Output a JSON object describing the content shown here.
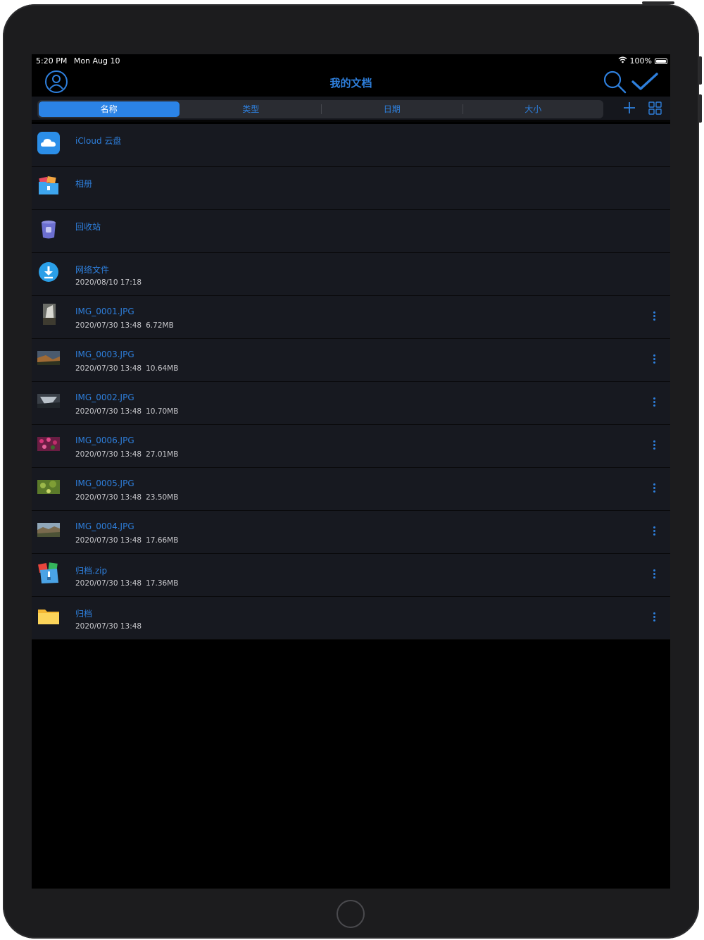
{
  "status_bar": {
    "time": "5:20 PM",
    "date": "Mon Aug 10",
    "battery": "100%",
    "icons": [
      "wifi-icon",
      "battery-icon"
    ]
  },
  "nav": {
    "title": "我的文档",
    "icons": [
      "profile-icon",
      "search-icon",
      "checkmark-icon"
    ]
  },
  "sort_tabs": [
    {
      "label": "名称",
      "active": true
    },
    {
      "label": "类型",
      "active": false
    },
    {
      "label": "日期",
      "active": false
    },
    {
      "label": "大小",
      "active": false
    }
  ],
  "toolbar_icons": [
    "add-icon",
    "grid-view-icon"
  ],
  "colors": {
    "accent": "#2e7fdc",
    "active_tab": "#2b83e6",
    "row_bg": "#171920",
    "screen_bg": "#000000"
  },
  "files": [
    {
      "name": "iCloud 云盘",
      "date": "",
      "size": "",
      "icon": "icloud-icon",
      "more": false
    },
    {
      "name": "相册",
      "date": "",
      "size": "",
      "icon": "photo-album-icon",
      "more": false
    },
    {
      "name": "回收站",
      "date": "",
      "size": "",
      "icon": "trash-icon",
      "more": false
    },
    {
      "name": "网络文件",
      "date": "2020/08/10 17:18",
      "size": "",
      "icon": "download-icon",
      "more": false
    },
    {
      "name": "IMG_0001.JPG",
      "date": "2020/07/30 13:48",
      "size": "6.72MB",
      "icon": "image-thumbnail-icon",
      "more": true
    },
    {
      "name": "IMG_0003.JPG",
      "date": "2020/07/30 13:48",
      "size": "10.64MB",
      "icon": "image-thumbnail-icon",
      "more": true
    },
    {
      "name": "IMG_0002.JPG",
      "date": "2020/07/30 13:48",
      "size": "10.70MB",
      "icon": "image-thumbnail-icon",
      "more": true
    },
    {
      "name": "IMG_0006.JPG",
      "date": "2020/07/30 13:48",
      "size": "27.01MB",
      "icon": "image-thumbnail-icon",
      "more": true
    },
    {
      "name": "IMG_0005.JPG",
      "date": "2020/07/30 13:48",
      "size": "23.50MB",
      "icon": "image-thumbnail-icon",
      "more": true
    },
    {
      "name": "IMG_0004.JPG",
      "date": "2020/07/30 13:48",
      "size": "17.66MB",
      "icon": "image-thumbnail-icon",
      "more": true
    },
    {
      "name": "归档.zip",
      "date": "2020/07/30 13:48",
      "size": "17.36MB",
      "icon": "zip-archive-icon",
      "more": true
    },
    {
      "name": "归档",
      "date": "2020/07/30 13:48",
      "size": "",
      "icon": "folder-icon",
      "more": true
    }
  ]
}
